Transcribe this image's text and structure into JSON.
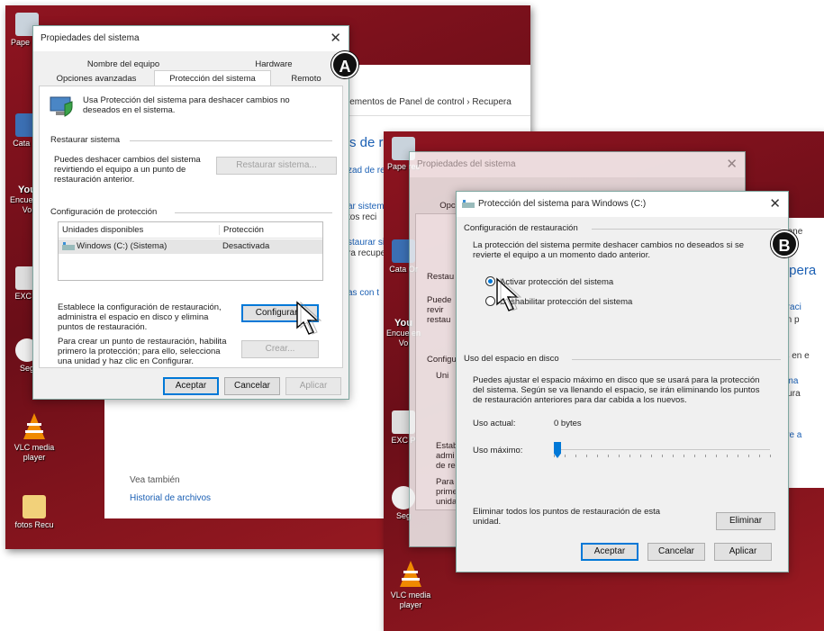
{
  "badges": {
    "a": "A",
    "b": "B"
  },
  "left": {
    "desktop_icons": [
      "Pape rec",
      "Cata Or",
      "Encue en Vo",
      "EXC P",
      "Seg",
      "VLC media player",
      "fotos Recu"
    ],
    "youtube_label": "You",
    "control_panel": {
      "breadcrumb": "lementos de Panel de control  ›  Recupera",
      "heading": "s de re",
      "links": [
        "zad de recu",
        "ar sistema",
        "tos reci",
        "staurar sistem",
        "ra recuperación",
        "as con t"
      ],
      "see_also": "Vea también",
      "history": "Historial de archivos"
    },
    "dialog": {
      "title": "Propiedades del sistema",
      "tabs_top": [
        "Nombre del equipo",
        "Hardware"
      ],
      "tabs_bottom": [
        "Opciones avanzadas",
        "Protección del sistema",
        "Remoto"
      ],
      "intro": "Usa Protección del sistema para deshacer cambios no deseados en el sistema.",
      "restore_section": "Restaurar sistema",
      "restore_text": "Puedes deshacer cambios del sistema revirtiendo el equipo a un punto de restauración anterior.",
      "restore_button": "Restaurar sistema...",
      "config_section": "Configuración de protección",
      "table_headers": [
        "Unidades disponibles",
        "Protección"
      ],
      "table_rows": [
        {
          "drive": "Windows (C:) (Sistema)",
          "status": "Desactivada"
        }
      ],
      "configure_text": "Establece la configuración de restauración, administra el espacio en disco y elimina puntos de restauración.",
      "configure_button": "Configurar...",
      "create_text": "Para crear un punto de restauración, habilita primero la protección; para ello, selecciona una unidad y haz clic en Configurar.",
      "create_button": "Crear...",
      "ok": "Aceptar",
      "cancel": "Cancelar",
      "apply": "Aplicar"
    }
  },
  "right": {
    "desktop_icons": [
      "Pape rec",
      "Cata Or",
      "Encue en Vo",
      "EXC P",
      "Seg",
      "VLC media player"
    ],
    "youtube_label": "You",
    "control_panel": {
      "breadcrumb": "de Pane",
      "heading": "ecupera",
      "links": [
        "cuperaci",
        "ración p",
        "antes en e",
        "sistema",
        "restaura",
        "PC, ve a"
      ]
    },
    "back_dialog": {
      "title": "Propiedades del sistema",
      "tab_stub": "Opci",
      "labels": [
        "Restau",
        "Puede revir restau",
        "Configu",
        "Uni",
        "Estab admi de re",
        "Para prime unida"
      ]
    },
    "dialog": {
      "title": "Protección del sistema para Windows (C:)",
      "restore_section": "Configuración de restauración",
      "restore_text": "La protección del sistema permite deshacer cambios no deseados si se revierte el equipo a un momento dado anterior.",
      "radio_on": "Activar protección del sistema",
      "radio_off": "Deshabilitar protección del sistema",
      "disk_section": "Uso del espacio en disco",
      "disk_text": "Puedes ajustar el espacio máximo en disco que se usará para la protección del sistema. Según se va llenando el espacio, se irán eliminando los puntos de restauración anteriores para dar cabida a los nuevos.",
      "current_label": "Uso actual:",
      "current_value": "0 bytes",
      "max_label": "Uso máximo:",
      "max_usage_fraction": 0,
      "delete_text": "Eliminar todos los puntos de restauración de esta unidad.",
      "delete_button": "Eliminar",
      "ok": "Aceptar",
      "cancel": "Cancelar",
      "apply": "Aplicar"
    }
  },
  "colors": {
    "desktop_red": "#8f1420",
    "link_blue": "#1a5fb4",
    "accent": "#0078d7"
  }
}
